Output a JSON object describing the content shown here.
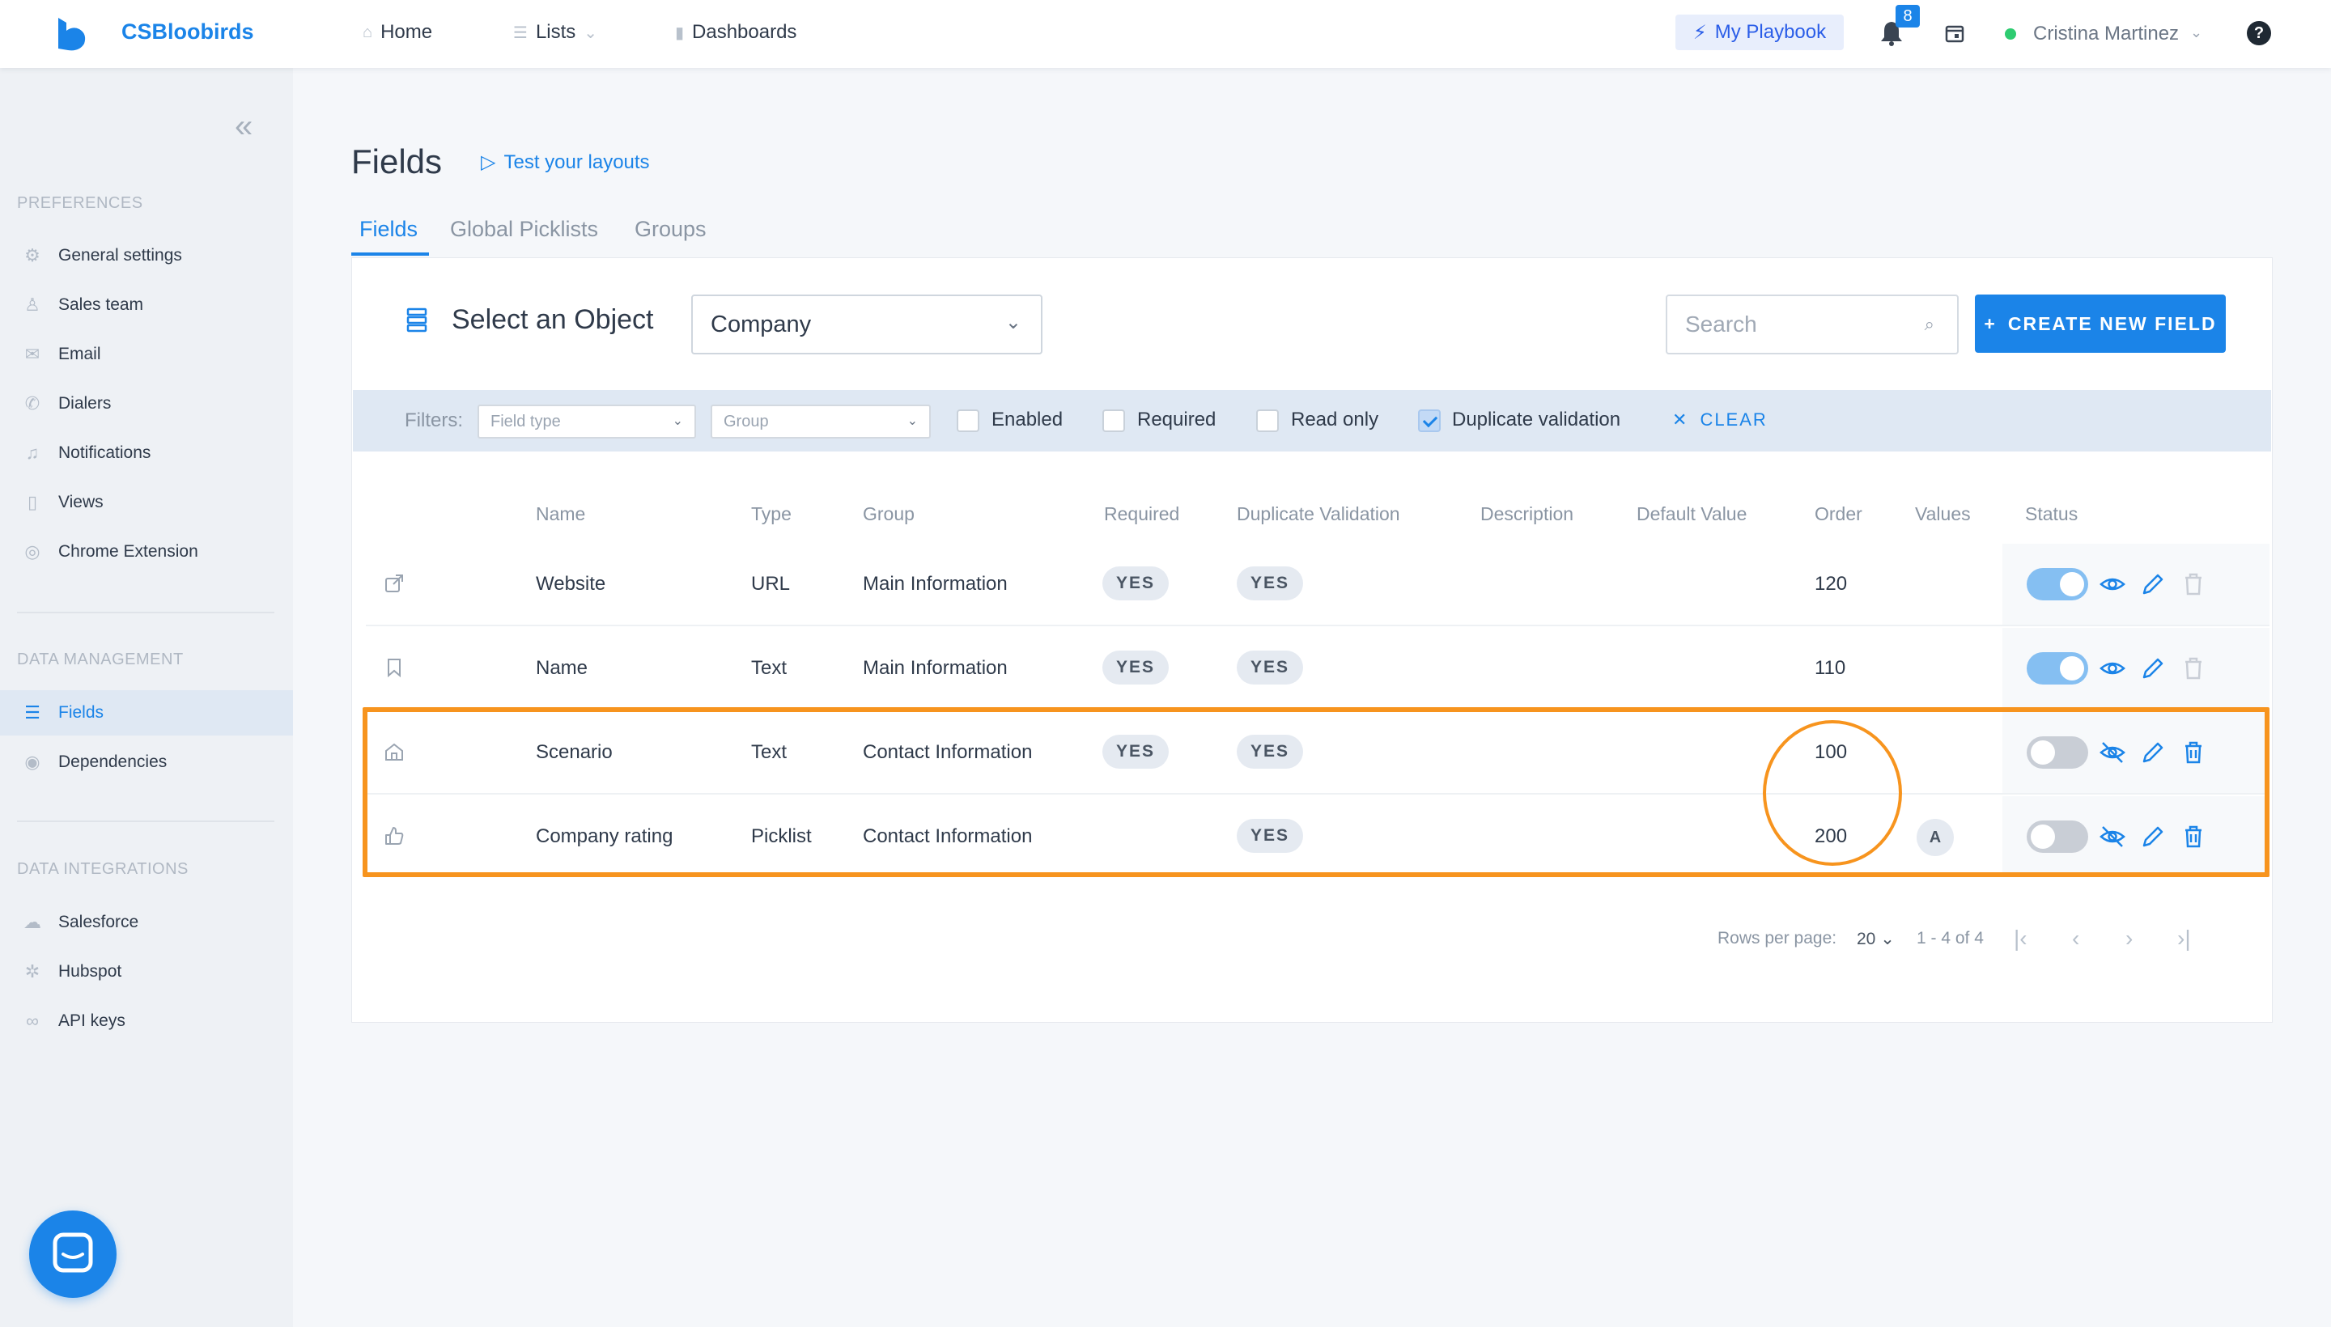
{
  "app": {
    "brand": "CSBloobirds",
    "colors": {
      "accent": "#1b84e8",
      "highlight": "#f7941e",
      "online": "#2ecc71"
    }
  },
  "topbar": {
    "nav": [
      {
        "label": "Home",
        "icon": "home-icon"
      },
      {
        "label": "Lists",
        "icon": "list-icon"
      },
      {
        "label": "Dashboards",
        "icon": "bar-chart-icon"
      }
    ],
    "playbook_label": "My Playbook",
    "notifications_count": "8",
    "user_name": "Cristina Martinez",
    "help_label": "?"
  },
  "sidebar": {
    "sections": [
      {
        "title": "PREFERENCES",
        "items": [
          {
            "label": "General settings",
            "icon": "gear-icon"
          },
          {
            "label": "Sales team",
            "icon": "user-icon"
          },
          {
            "label": "Email",
            "icon": "mail-icon"
          },
          {
            "label": "Dialers",
            "icon": "phone-icon"
          },
          {
            "label": "Notifications",
            "icon": "bell-icon"
          },
          {
            "label": "Views",
            "icon": "document-icon"
          },
          {
            "label": "Chrome Extension",
            "icon": "chrome-icon"
          }
        ]
      },
      {
        "title": "DATA MANAGEMENT",
        "items": [
          {
            "label": "Fields",
            "icon": "fields-icon",
            "active": true
          },
          {
            "label": "Dependencies",
            "icon": "eye-icon"
          }
        ]
      },
      {
        "title": "DATA INTEGRATIONS",
        "items": [
          {
            "label": "Salesforce",
            "icon": "cloud-icon"
          },
          {
            "label": "Hubspot",
            "icon": "hubspot-icon"
          },
          {
            "label": "API keys",
            "icon": "link-icon"
          }
        ]
      }
    ]
  },
  "page": {
    "title": "Fields",
    "test_layouts_label": "Test your layouts",
    "tabs": [
      {
        "label": "Fields",
        "active": true
      },
      {
        "label": "Global Picklists"
      },
      {
        "label": "Groups"
      }
    ]
  },
  "object_selector": {
    "label": "Select an Object",
    "value": "Company"
  },
  "search": {
    "placeholder": "Search"
  },
  "create_button": {
    "label": "CREATE NEW FIELD"
  },
  "filters": {
    "label": "Filters:",
    "field_type_placeholder": "Field type",
    "group_placeholder": "Group",
    "checkboxes": [
      {
        "label": "Enabled",
        "checked": false
      },
      {
        "label": "Required",
        "checked": false
      },
      {
        "label": "Read only",
        "checked": false
      },
      {
        "label": "Duplicate validation",
        "checked": true
      }
    ],
    "clear_label": "CLEAR"
  },
  "table": {
    "columns": [
      "Name",
      "Type",
      "Group",
      "Required",
      "Duplicate Validation",
      "Description",
      "Default Value",
      "Order",
      "Values",
      "Status"
    ],
    "rows": [
      {
        "icon": "external-link-icon",
        "name": "Website",
        "type": "URL",
        "group": "Main Information",
        "required": "YES",
        "duplicate": "YES",
        "description": "",
        "default": "",
        "order": "120",
        "values": "",
        "enabled": true
      },
      {
        "icon": "bookmark-icon",
        "name": "Name",
        "type": "Text",
        "group": "Main Information",
        "required": "YES",
        "duplicate": "YES",
        "description": "",
        "default": "",
        "order": "110",
        "values": "",
        "enabled": true
      },
      {
        "icon": "home-icon",
        "name": "Scenario",
        "type": "Text",
        "group": "Contact Information",
        "required": "YES",
        "duplicate": "YES",
        "description": "",
        "default": "",
        "order": "100",
        "values": "",
        "enabled": false
      },
      {
        "icon": "thumbs-up-icon",
        "name": "Company rating",
        "type": "Picklist",
        "group": "Contact Information",
        "required": "",
        "duplicate": "YES",
        "description": "",
        "default": "",
        "order": "200",
        "values": "A",
        "enabled": false
      }
    ]
  },
  "pagination": {
    "rows_per_page_label": "Rows per page:",
    "rows_per_page": "20",
    "range": "1 - 4 of 4"
  }
}
